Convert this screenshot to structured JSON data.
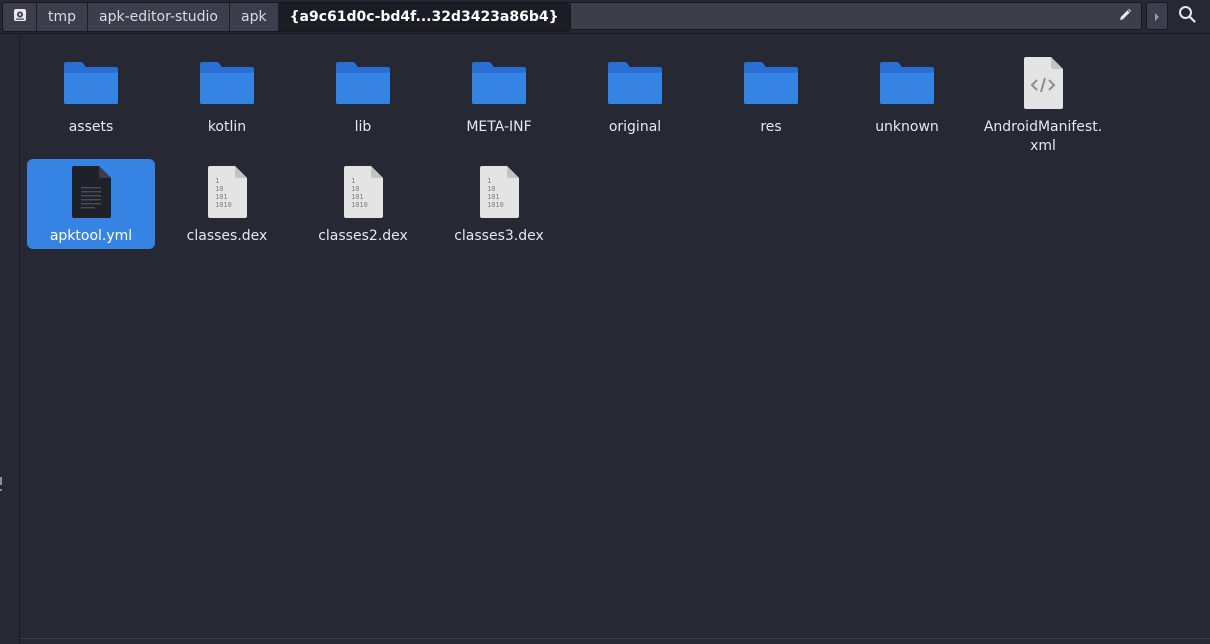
{
  "pathbar": {
    "crumbs": [
      "tmp",
      "apk-editor-studio",
      "apk"
    ],
    "current": "{a9c61d0c-bd4f...32d3423a86b4}"
  },
  "colors": {
    "background": "#262833",
    "folder": "#3584e4",
    "selection": "#3584e4",
    "file_sheet": "#e4e4e4"
  },
  "files": [
    {
      "name": "assets",
      "icon": "folder-icon"
    },
    {
      "name": "kotlin",
      "icon": "folder-icon"
    },
    {
      "name": "lib",
      "icon": "folder-icon"
    },
    {
      "name": "META-INF",
      "icon": "folder-icon"
    },
    {
      "name": "original",
      "icon": "folder-icon"
    },
    {
      "name": "res",
      "icon": "folder-icon"
    },
    {
      "name": "unknown",
      "icon": "folder-icon"
    },
    {
      "name": "AndroidManifest.xml",
      "icon": "xml-file-icon"
    },
    {
      "name": "apktool.yml",
      "icon": "text-file-icon",
      "selected": true
    },
    {
      "name": "classes.dex",
      "icon": "binary-file-icon"
    },
    {
      "name": "classes2.dex",
      "icon": "binary-file-icon"
    },
    {
      "name": "classes3.dex",
      "icon": "binary-file-icon"
    }
  ]
}
